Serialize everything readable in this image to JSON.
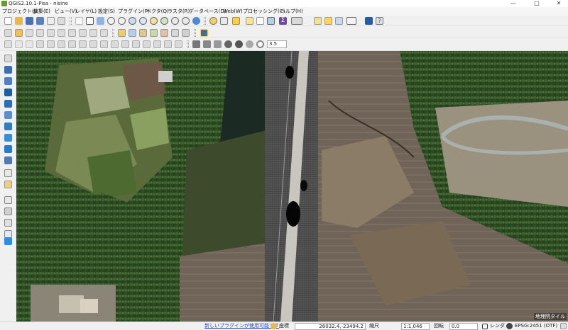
{
  "window": {
    "title": "QGIS2.10.1-Pisa - nisine",
    "minimize_glyph": "—",
    "maximize_glyph": "□",
    "close_glyph": "✕"
  },
  "menu": {
    "items": [
      {
        "label": "プロジェクト(J)"
      },
      {
        "label": "編集(E)"
      },
      {
        "label": "ビュー(V)"
      },
      {
        "label": "レイヤ(L)"
      },
      {
        "label": "設定(S)"
      },
      {
        "label": "プラグイン(P)"
      },
      {
        "label": "ベクタ(Q)"
      },
      {
        "label": "ラスタ(R)"
      },
      {
        "label": "データベース(D)"
      },
      {
        "label": "Web(W)"
      },
      {
        "label": "プロセッシング(C)"
      },
      {
        "label": "ヘルプ(H)"
      }
    ]
  },
  "toolbar": {
    "zoom_value": "3.5"
  },
  "map": {
    "credit": "地理院タイル"
  },
  "status": {
    "plugin_link": "新しいプラグインが使用可能です",
    "coord_label": "座標",
    "coord_value": "26032.4,-23494.2",
    "scale_label": "縮尺",
    "scale_value": "1:1,046",
    "rotation_label": "回転",
    "rotation_value": "0.0",
    "render_label": "レンダ",
    "crs": "EPSG:2451 (OTF)"
  },
  "colors": {
    "map_dark": "#2f3a22",
    "field_brown": "#7a6a55",
    "road_grey": "#c9c6bf",
    "link_blue": "#1d4fd6"
  }
}
